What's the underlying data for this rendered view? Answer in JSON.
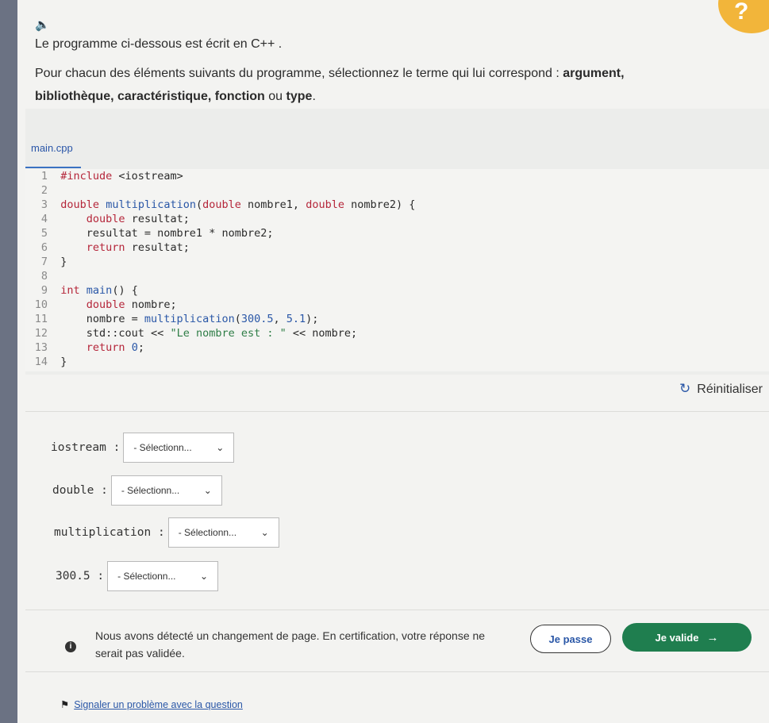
{
  "intro": {
    "speaker_icon": "speaker-icon",
    "line1": "Le programme ci-dessous est écrit en C++ .",
    "line2_prefix": "Pour chacun des éléments suivants du programme, sélectionnez le terme qui lui correspond : ",
    "terms": [
      "argument,",
      "bibliothèque,",
      "caractéristique,",
      "fonction",
      "type"
    ],
    "sep_or": "ou",
    "end": "."
  },
  "editor": {
    "filename": "main.cpp",
    "lines": [
      {
        "n": "1",
        "t": "#include <iostream>"
      },
      {
        "n": "2",
        "t": ""
      },
      {
        "n": "3",
        "t": "double multiplication(double nombre1, double nombre2) {"
      },
      {
        "n": "4",
        "t": "    double resultat;"
      },
      {
        "n": "5",
        "t": "    resultat = nombre1 * nombre2;"
      },
      {
        "n": "6",
        "t": "    return resultat;"
      },
      {
        "n": "7",
        "t": "}"
      },
      {
        "n": "8",
        "t": ""
      },
      {
        "n": "9",
        "t": "int main() {"
      },
      {
        "n": "10",
        "t": "    double nombre;"
      },
      {
        "n": "11",
        "t": "    nombre = multiplication(300.5, 5.1);"
      },
      {
        "n": "12",
        "t": "    std::cout << \"Le nombre est : \" << nombre;"
      },
      {
        "n": "13",
        "t": "    return 0;"
      },
      {
        "n": "14",
        "t": "}"
      }
    ]
  },
  "reset_label": "Réinitialiser",
  "questions": [
    {
      "label": "iostream :",
      "value": "- Sélectionn..."
    },
    {
      "label": "double :",
      "value": "- Sélectionn..."
    },
    {
      "label": "multiplication :",
      "value": "- Sélectionn..."
    },
    {
      "label": "300.5 :",
      "value": "- Sélectionn..."
    }
  ],
  "notice": "Nous avons détecté un changement de page. En certification, votre réponse ne serait pas validée.",
  "buttons": {
    "skip": "Je passe",
    "validate": "Je valide"
  },
  "report": "Signaler un problème avec la question",
  "colors": {
    "accent": "#2a57a7",
    "validate_bg": "#1f7e4f",
    "badge": "#f2b53a"
  }
}
